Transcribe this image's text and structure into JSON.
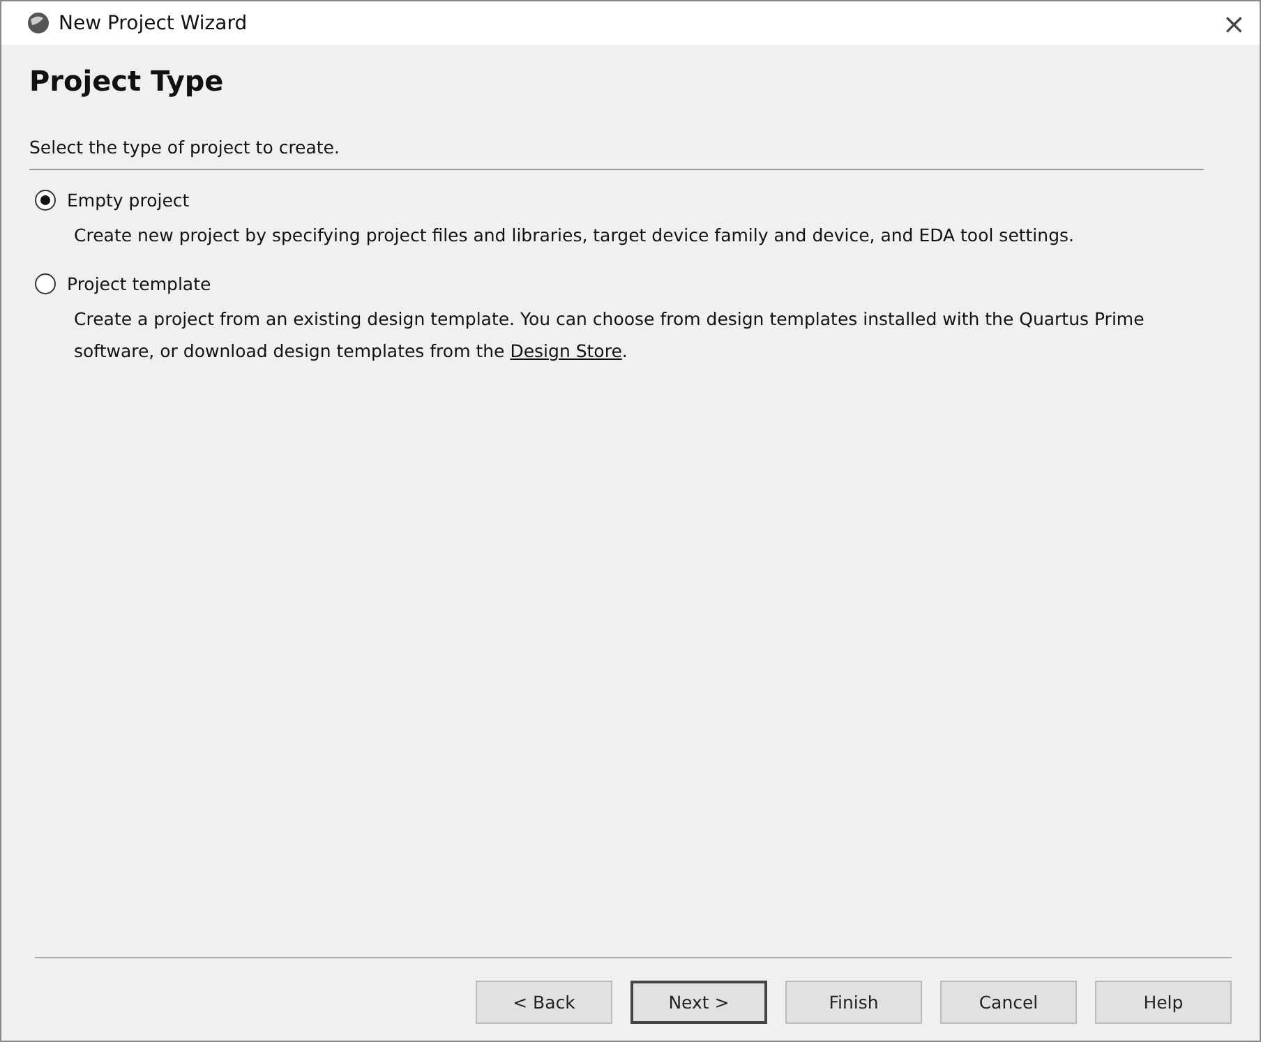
{
  "window": {
    "title": "New Project Wizard",
    "close": "×"
  },
  "header": {
    "title": "Project Type",
    "subtitle": "Select the type of project to create."
  },
  "options": [
    {
      "label": "Empty project",
      "selected": true,
      "description": "Create new project by specifying project files and libraries, target device family and device, and EDA tool settings."
    },
    {
      "label": "Project template",
      "selected": false,
      "description": "Create a project from an existing design template. You can choose from design templates installed with the Quartus Prime software, or download design templates from the ",
      "link": "Design Store",
      "after_link": "."
    }
  ],
  "buttons": [
    {
      "label": "< Back",
      "default": false
    },
    {
      "label": "Next >",
      "default": true
    },
    {
      "label": "Finish",
      "default": false
    },
    {
      "label": "Cancel",
      "default": false
    },
    {
      "label": "Help",
      "default": false
    }
  ]
}
